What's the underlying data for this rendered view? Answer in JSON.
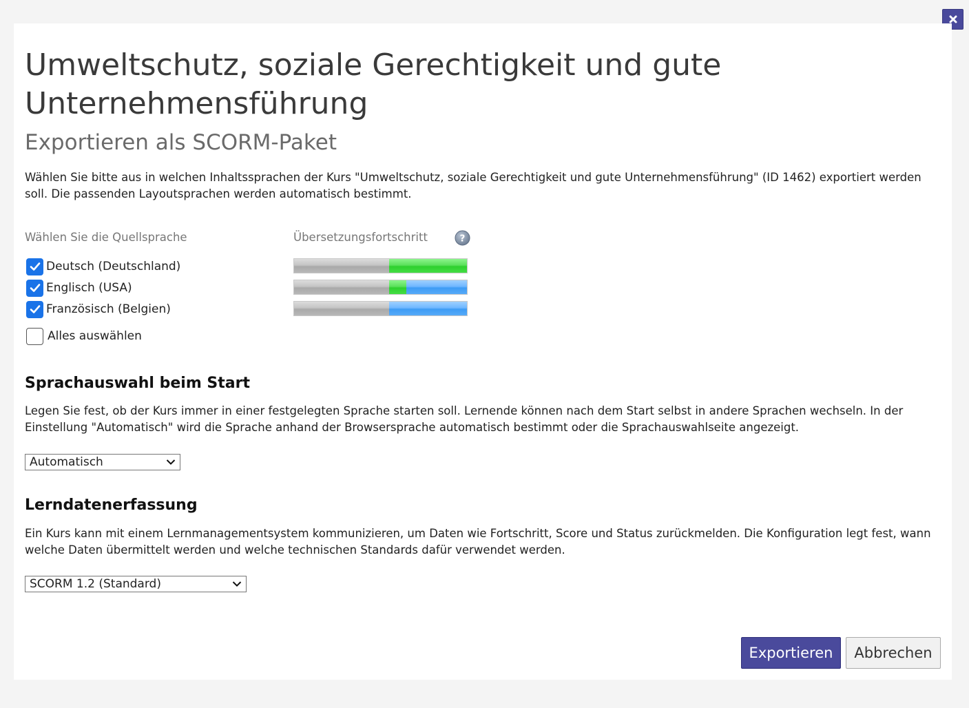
{
  "dialog": {
    "title": "Umweltschutz, soziale Gerechtigkeit und gute Unternehmensführung",
    "subtitle": "Exportieren als SCORM-Paket",
    "intro": "Wählen Sie bitte aus in welchen Inhaltssprachen der Kurs \"Umweltschutz, soziale Gerechtigkeit und gute Unternehmensführung\" (ID 1462) exportiert werden soll. Die passenden Layoutsprachen werden automatisch bestimmt."
  },
  "languages": {
    "source_header": "Wählen Sie die Quellsprache",
    "progress_header": "Übersetzungsfortschritt",
    "help_icon": "question-circle-icon",
    "items": [
      {
        "label": "Deutsch (Deutschland)",
        "checked": true,
        "progress": {
          "grey": 0.55,
          "green": 0.45,
          "blue": 0.0
        }
      },
      {
        "label": "Englisch (USA)",
        "checked": true,
        "progress": {
          "grey": 0.55,
          "green": 0.1,
          "blue": 0.35
        }
      },
      {
        "label": "Französisch (Belgien)",
        "checked": true,
        "progress": {
          "grey": 0.55,
          "green": 0.0,
          "blue": 0.45
        }
      }
    ],
    "select_all_label": "Alles auswählen",
    "select_all_checked": false
  },
  "start_language": {
    "heading": "Sprachauswahl beim Start",
    "description": "Legen Sie fest, ob der Kurs immer in einer festgelegten Sprache starten soll. Lernende können nach dem Start selbst in andere Sprachen wechseln. In der Einstellung \"Automatisch\" wird die Sprache anhand der Browsersprache automatisch bestimmt oder die Sprachauswahlseite angezeigt.",
    "selected": "Automatisch"
  },
  "tracking": {
    "heading": "Lerndatenerfassung",
    "description": "Ein Kurs kann mit einem Lernmanagementsystem kommunizieren, um Daten wie Fortschritt, Score und Status zurückmelden. Die Konfiguration legt fest, wann welche Daten übermittelt werden und welche technischen Standards dafür verwendet werden.",
    "selected": "SCORM 1.2 (Standard)"
  },
  "buttons": {
    "export": "Exportieren",
    "cancel": "Abbrechen"
  },
  "colors": {
    "primary": "#4a4a9c",
    "checkbox": "#1a73e8",
    "progress_green": "#2ed02e",
    "progress_blue": "#3e9cf5",
    "progress_grey": "#b0b0b0"
  }
}
